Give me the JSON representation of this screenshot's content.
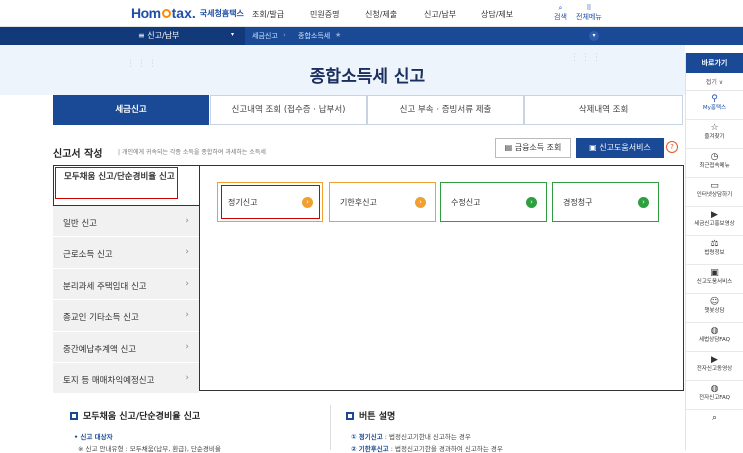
{
  "header": {
    "logo_home": "Hom",
    "logo_tax": "tax.",
    "logo_org": "국세청홈택스",
    "gnb": [
      "조회/발급",
      "민원증명",
      "신청/제출",
      "신고/납부",
      "상담/제보"
    ],
    "search_label": "검색",
    "allmenu_label": "전체메뉴"
  },
  "navbar": {
    "menu": "≡  신고/납부",
    "crumb1": "세금신고",
    "crumb2": "종합소득세"
  },
  "page": {
    "title": "종합소득세 신고",
    "tabs": [
      "세금신고",
      "신고내역 조회 (접수증 · 납부서)",
      "신고 부속 · 증빙서류 제출",
      "삭제내역 조회"
    ]
  },
  "section": {
    "title": "신고서 작성",
    "desc": "개인에게 귀속되는 각종 소득을 종합하여 과세하는 소득세",
    "btn_fin": "금융소득 조회",
    "btn_help": "신고도움서비스"
  },
  "side_items": [
    "모두채움 신고/단순경비율 신고",
    "일반 신고",
    "근로소득 신고",
    "분리과세 주택임대 신고",
    "종교인 기타소득 신고",
    "중간예납추계액 신고",
    "토지 등 매매차익예정신고"
  ],
  "cards": [
    "정기신고",
    "기한후신고",
    "수정신고",
    "경정청구"
  ],
  "info": {
    "left_title": "모두채움 신고/단순경비율 신고",
    "left_line1": "• 신고 대상자",
    "left_line2": "※ 신고 안내유형 : 모두채움(납부, 환급), 단순경비율",
    "right_title": "버튼 설명",
    "right_line1_key": "① 정기신고",
    "right_line1": " : 법정신고기한내 신고하는 경우",
    "right_line2_key": "② 기한후신고",
    "right_line2": " : 법정신고기한을 경과하여 신고하는 경우"
  },
  "rightbar": {
    "head": "바로가기",
    "fold": "접기 ∨",
    "items": [
      "My홈택스",
      "즐겨찾기",
      "최근접속메뉴",
      "인터넷상담하기",
      "세금신고홍보영상",
      "법령정보",
      "신고도움서비스",
      "챗봇상담",
      "세법상담FAQ",
      "전자신고동영상",
      "전자신고FAQ"
    ]
  },
  "colors": {
    "primary": "#1a4a95",
    "highlight": "#d10000",
    "orange": "#f0a030",
    "green": "#2e9e3e"
  }
}
